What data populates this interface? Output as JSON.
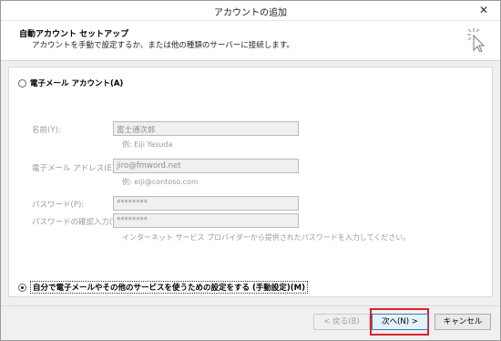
{
  "window": {
    "title": "アカウントの追加",
    "close_glyph": "✕"
  },
  "header": {
    "title": "自動アカウント セットアップ",
    "description": "アカウントを手動で設定するか、または他の種類のサーバーに接続します。"
  },
  "options": {
    "email_account_label": "電子メール アカウント(A)",
    "manual_setup_label": "自分で電子メールやその他のサービスを使うための設定をする (手動設定)(M)",
    "selected": "manual"
  },
  "fields": {
    "name_label": "名前(Y):",
    "name_value": "富士通次郎",
    "name_hint": "例: Eiji Yasuda",
    "email_label": "電子メール アドレス(E):",
    "email_value": "jiro@fmword.net",
    "email_hint": "例: eiji@contoso.com",
    "password_label": "パスワード(P):",
    "password_value": "********",
    "password_confirm_label": "パスワードの確認入力(T):",
    "password_confirm_value": "********",
    "password_hint": "インターネット サービス プロバイダーから提供されたパスワードを入力してください。"
  },
  "buttons": {
    "back": "< 戻る(B)",
    "next": "次へ(N) >",
    "cancel": "キャンセル"
  },
  "colors": {
    "highlight": "#e0202a",
    "disabled_text": "#9a9a9a"
  }
}
